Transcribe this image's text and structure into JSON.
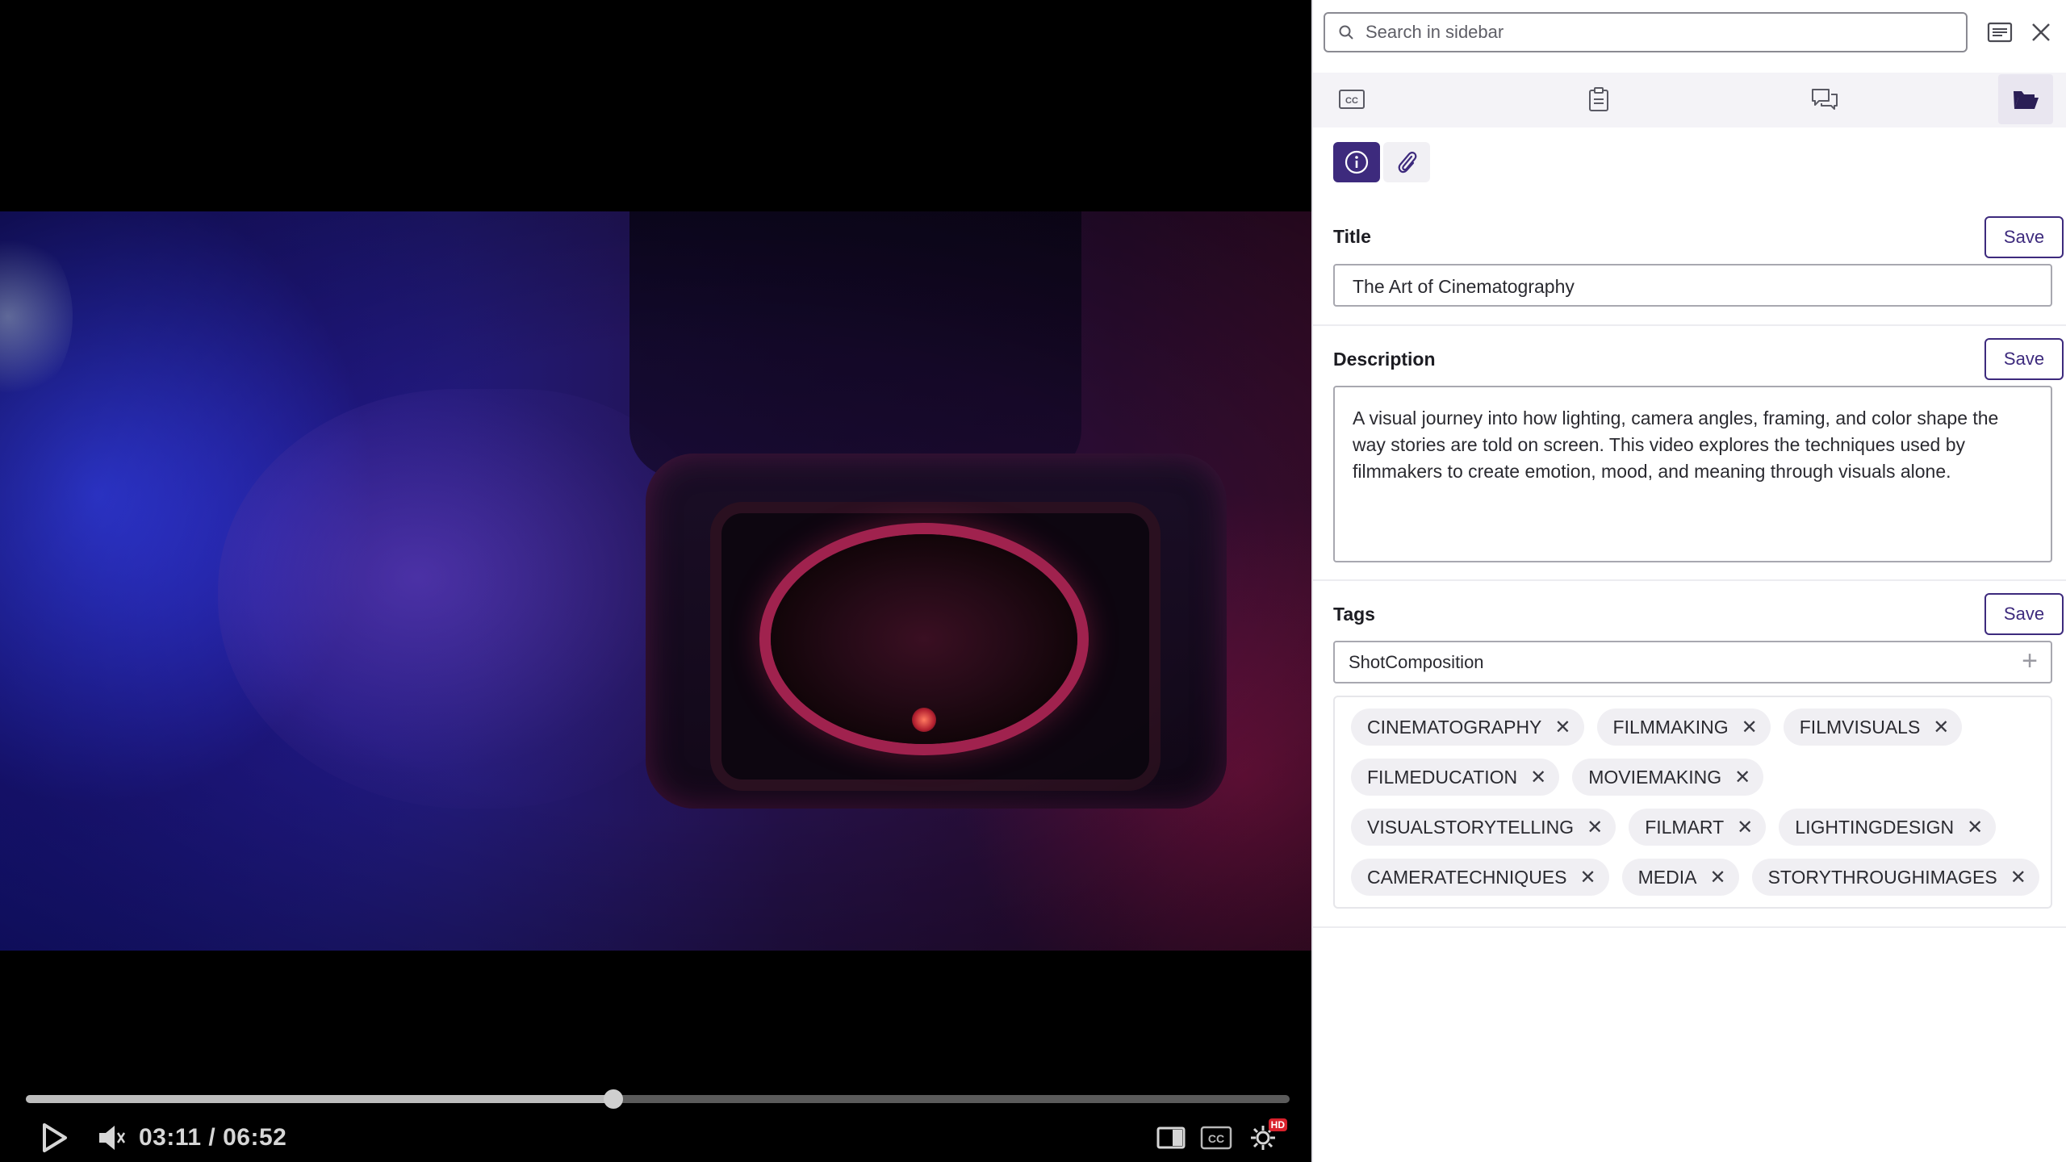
{
  "player": {
    "time_display": "03:11 / 06:52",
    "current_time": "03:11",
    "duration": "06:52",
    "progress_fraction": 0.465,
    "quality_badge": "HD",
    "icons": {
      "play": "play-icon",
      "volume": "volume-icon",
      "theater": "theater-mode-icon",
      "captions": "closed-captions-icon",
      "settings": "settings-gear-icon"
    }
  },
  "sidebar": {
    "search": {
      "placeholder": "Search in sidebar",
      "value": ""
    },
    "top_icons": [
      "transcript-icon",
      "close-icon"
    ],
    "tabs": [
      "captions-tab-icon",
      "notes-tab-icon",
      "comments-tab-icon",
      "folder-tab-icon"
    ],
    "active_tab": "folder-tab-icon",
    "subtabs": [
      "info-icon",
      "attachment-icon"
    ],
    "active_subtab": "info-icon",
    "title": {
      "label": "Title",
      "save_label": "Save",
      "value": "The Art of Cinematography"
    },
    "description": {
      "label": "Description",
      "save_label": "Save",
      "value": "A visual journey into how lighting, camera angles, framing, and color shape the way stories are told on screen. This video explores the techniques used by filmmakers to create emotion, mood, and meaning through visuals alone."
    },
    "tags": {
      "label": "Tags",
      "save_label": "Save",
      "input_value": "ShotComposition",
      "add_icon": "plus-icon",
      "rows": [
        [
          "CINEMATOGRAPHY",
          "FILMMAKING",
          "FILMVISUALS"
        ],
        [
          "FILMEDUCATION",
          "MOVIEMAKING"
        ],
        [
          "VISUALSTORYTELLING",
          "FILMART",
          "LIGHTINGDESIGN"
        ],
        [
          "CAMERATECHNIQUES",
          "MEDIA",
          "STORYTHROUGHIMAGES"
        ]
      ]
    }
  },
  "colors": {
    "accent": "#3d2a7d",
    "player_bg": "#000000",
    "chip_bg": "#f0eff3",
    "hd_badge": "#d9212c"
  }
}
